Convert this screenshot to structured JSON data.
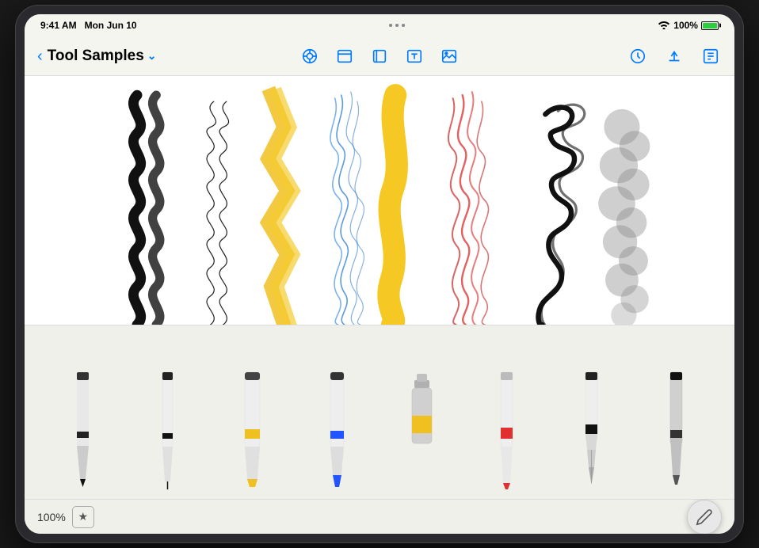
{
  "status_bar": {
    "time": "9:41 AM",
    "date": "Mon Jun 10",
    "wifi_label": "WiFi",
    "battery_percent": "100%"
  },
  "toolbar": {
    "back_label": "‹",
    "title": "Tool Samples",
    "dropdown_icon": "chevron-down",
    "center_icons": [
      {
        "name": "pen-tool-icon",
        "tooltip": "Pen Tool"
      },
      {
        "name": "browser-icon",
        "tooltip": "Browser"
      },
      {
        "name": "layers-icon",
        "tooltip": "Layers"
      },
      {
        "name": "text-icon",
        "tooltip": "Text"
      },
      {
        "name": "image-icon",
        "tooltip": "Image"
      }
    ],
    "right_icons": [
      {
        "name": "history-icon",
        "tooltip": "History"
      },
      {
        "name": "share-icon",
        "tooltip": "Share"
      },
      {
        "name": "edit-icon",
        "tooltip": "Edit"
      }
    ]
  },
  "canvas": {
    "background": "#ffffff",
    "strokes": [
      {
        "id": "stroke1",
        "type": "squiggle-thick",
        "color": "#111111",
        "desc": "thick black squiggle"
      },
      {
        "id": "stroke2",
        "type": "loop-thin",
        "color": "#222222",
        "desc": "thin loopy line"
      },
      {
        "id": "stroke3",
        "type": "marker-zigzag",
        "color": "#f5c518",
        "desc": "yellow marker zigzag"
      },
      {
        "id": "stroke4",
        "type": "pencil-scribble",
        "color": "#4a90d9",
        "desc": "blue pencil scribble"
      },
      {
        "id": "stroke5",
        "type": "paint-wave",
        "color": "#f5c518",
        "desc": "yellow paint wave"
      },
      {
        "id": "stroke6",
        "type": "crayon-scribble",
        "color": "#e05050",
        "desc": "red crayon scribble"
      },
      {
        "id": "stroke7",
        "type": "calligraphy-swirl",
        "color": "#111111",
        "desc": "black calligraphy swirl"
      },
      {
        "id": "stroke8",
        "type": "airbrush-cloud",
        "color": "#888888",
        "desc": "gray airbrush cloud"
      }
    ]
  },
  "tools": [
    {
      "id": "tool1",
      "name": "Pen",
      "color": "#222222",
      "band_color": "#111111",
      "tip_color": "#111111"
    },
    {
      "id": "tool2",
      "name": "Fineliner",
      "color": "#eeeeee",
      "band_color": "#111111",
      "tip_color": "#111111"
    },
    {
      "id": "tool3",
      "name": "Marker",
      "color": "#eeeeee",
      "band_color": "#f0c020",
      "tip_color": "#f0c020"
    },
    {
      "id": "tool4",
      "name": "Brush Pen",
      "color": "#eeeeee",
      "band_color": "#2255ff",
      "tip_color": "#2255ff"
    },
    {
      "id": "tool5",
      "name": "Paint",
      "color": "#cccccc",
      "band_color": "#f0c020",
      "tip_color": "#cccccc"
    },
    {
      "id": "tool6",
      "name": "Crayon",
      "color": "#eeeeee",
      "band_color": "#e03030",
      "tip_color": "#e03030"
    },
    {
      "id": "tool7",
      "name": "Calligraphy",
      "color": "#eeeeee",
      "band_color": "#111111",
      "tip_color": "#111111"
    },
    {
      "id": "tool8",
      "name": "Airbrush",
      "color": "#cccccc",
      "band_color": "#111111",
      "tip_color": "#555555"
    }
  ],
  "bottom_bar": {
    "zoom": "100%",
    "favorite_icon": "★",
    "pencil_icon": "✏"
  }
}
